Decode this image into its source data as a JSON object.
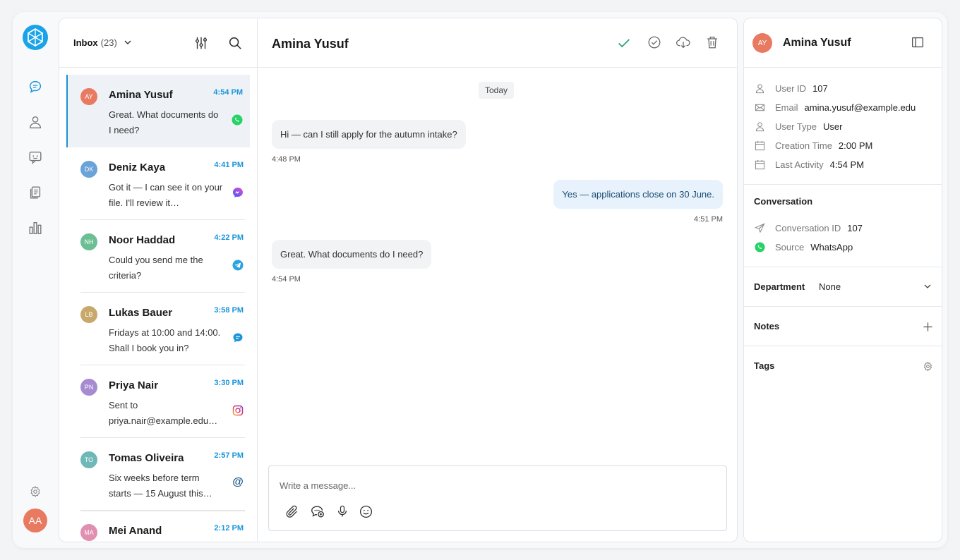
{
  "nav": {
    "me_initials": "AA"
  },
  "inbox": {
    "title": "Inbox",
    "count": "(23)"
  },
  "conversations": [
    {
      "initials": "AY",
      "name": "Amina Yusuf",
      "time": "4:54 PM",
      "snippet": "Great. What documents do I need?",
      "channel": "whatsapp",
      "color": "#e97a62"
    },
    {
      "initials": "DK",
      "name": "Deniz Kaya",
      "time": "4:41 PM",
      "snippet": "Got it — I can see it on your file. I'll review it…",
      "channel": "messenger",
      "color": "#6aa3d8"
    },
    {
      "initials": "NH",
      "name": "Noor Haddad",
      "time": "4:22 PM",
      "snippet": "Could you send me the criteria?",
      "channel": "telegram",
      "color": "#6cbf93"
    },
    {
      "initials": "LB",
      "name": "Lukas Bauer",
      "time": "3:58 PM",
      "snippet": "Fridays at 10:00 and 14:00. Shall I book you in?",
      "channel": "chat",
      "color": "#c9a86b"
    },
    {
      "initials": "PN",
      "name": "Priya Nair",
      "time": "3:30 PM",
      "snippet": "Sent to priya.nair@example.edu…",
      "channel": "instagram",
      "color": "#a78bd0"
    },
    {
      "initials": "TO",
      "name": "Tomas Oliveira",
      "time": "2:57 PM",
      "snippet": "Six weeks before term starts — 15 August this…",
      "channel": "email",
      "color": "#6fb8b8"
    },
    {
      "initials": "MA",
      "name": "Mei Anand",
      "time": "2:12 PM",
      "snippet": "",
      "channel": "chat",
      "color": "#e08fb0"
    }
  ],
  "conversation": {
    "title": "Amina Yusuf",
    "date_label": "Today",
    "messages": [
      {
        "text": "Hi — can I still apply for the autumn intake?",
        "time": "4:48 PM",
        "dir": "in"
      },
      {
        "text": "Yes — applications close on 30 June.",
        "time": "4:51 PM",
        "dir": "out"
      },
      {
        "text": "Great. What documents do I need?",
        "time": "4:54 PM",
        "dir": "in"
      }
    ],
    "composer_placeholder": "Write a message..."
  },
  "details": {
    "initials": "AY",
    "name": "Amina Yusuf",
    "user": [
      {
        "label": "User ID",
        "value": "107",
        "icon": "user-icon"
      },
      {
        "label": "Email",
        "value": "amina.yusuf@example.edu",
        "icon": "mail-icon"
      },
      {
        "label": "User Type",
        "value": "User",
        "icon": "user-icon"
      },
      {
        "label": "Creation Time",
        "value": "2:00 PM",
        "icon": "calendar-icon"
      },
      {
        "label": "Last Activity",
        "value": "4:54 PM",
        "icon": "calendar-icon"
      }
    ],
    "conversation_section": "Conversation",
    "conv_rows": [
      {
        "label": "Conversation ID",
        "value": "107",
        "icon": "send-icon"
      },
      {
        "label": "Source",
        "value": "WhatsApp",
        "icon": "whatsapp-icon"
      }
    ],
    "department_label": "Department",
    "department_value": "None",
    "notes_label": "Notes",
    "tags_label": "Tags"
  },
  "colors": {
    "accent": "#1a95d9",
    "check": "#3aa57a"
  }
}
